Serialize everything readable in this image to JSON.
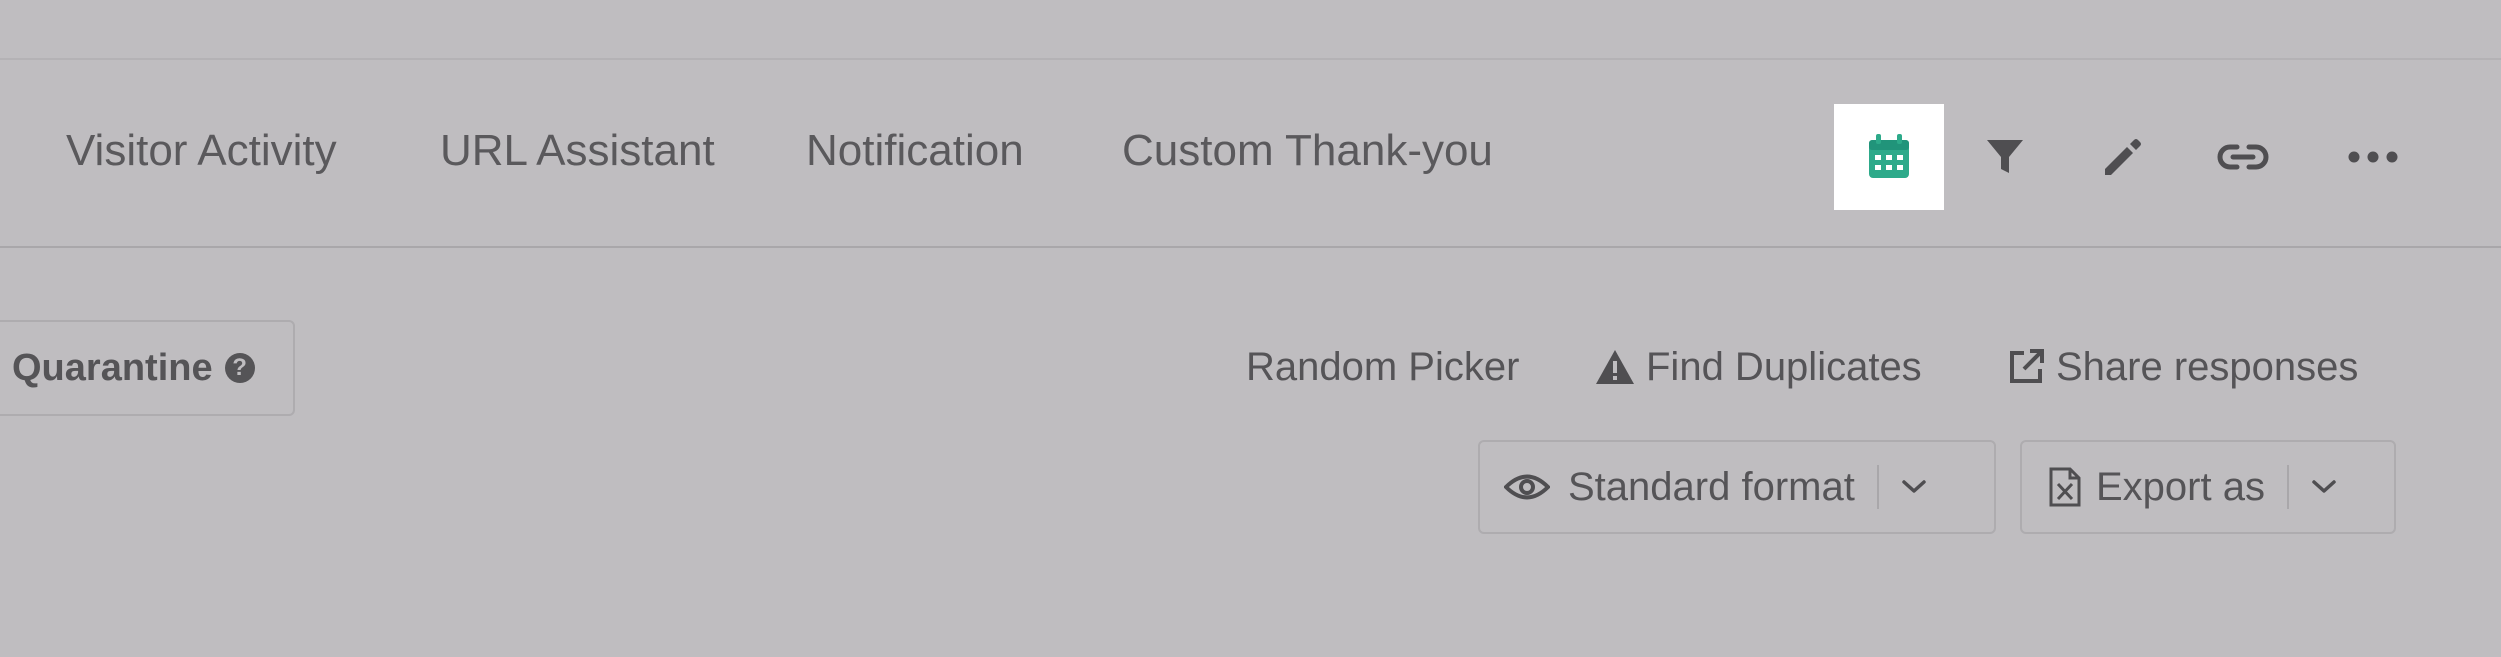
{
  "tabs": [
    {
      "label": "Visitor Activity"
    },
    {
      "label": "URL Assistant"
    },
    {
      "label": "Notification"
    },
    {
      "label": "Custom Thank-you"
    }
  ],
  "toolbar": {
    "icons": [
      "calendar-icon",
      "filter-icon",
      "pencil-icon",
      "link-icon",
      "more-icon"
    ],
    "active_icon": "calendar-icon",
    "accent_color": "#2daa8a"
  },
  "quarantine": {
    "label": "Quarantine"
  },
  "actions": {
    "random_picker": "Random Picker",
    "find_duplicates": "Find Duplicates",
    "share_responses": "Share responses"
  },
  "view_format": {
    "selected": "Standard format"
  },
  "export": {
    "label": "Export as"
  }
}
